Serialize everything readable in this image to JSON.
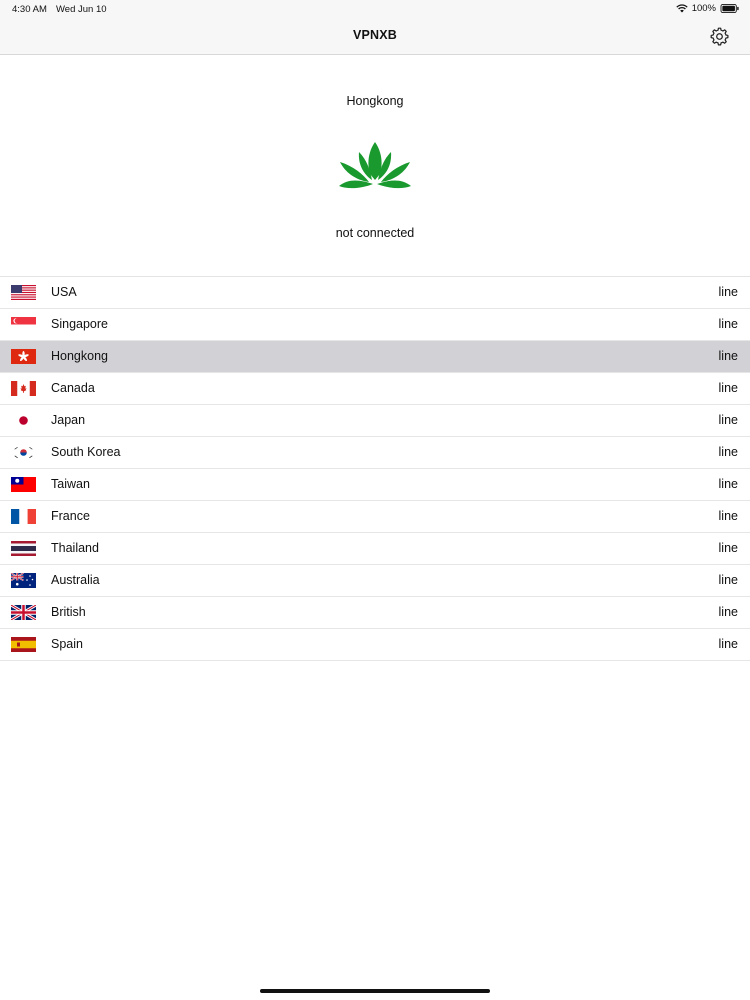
{
  "status_bar": {
    "time": "4:30 AM",
    "date": "Wed Jun 10",
    "battery": "100%"
  },
  "nav": {
    "title": "VPNXB",
    "settings_icon": "gear-icon"
  },
  "current": {
    "server": "Hongkong",
    "status": "not connected",
    "logo_color": "#1a9a2e"
  },
  "colors": {
    "selected_row": "#d2d1d6",
    "divider": "#e6e6e6",
    "nav_bg": "#f7f7f7"
  },
  "servers": [
    {
      "name": "USA",
      "line": "line",
      "flag": "us-flag-icon"
    },
    {
      "name": "Singapore",
      "line": "line",
      "flag": "singapore-flag-icon"
    },
    {
      "name": "Hongkong",
      "line": "line",
      "flag": "hongkong-flag-icon",
      "selected": true
    },
    {
      "name": "Canada",
      "line": "line",
      "flag": "canada-flag-icon"
    },
    {
      "name": "Japan",
      "line": "line",
      "flag": "japan-flag-icon"
    },
    {
      "name": "South Korea",
      "line": "line",
      "flag": "south-korea-flag-icon"
    },
    {
      "name": "Taiwan",
      "line": "line",
      "flag": "taiwan-flag-icon"
    },
    {
      "name": "France",
      "line": "line",
      "flag": "france-flag-icon"
    },
    {
      "name": "Thailand",
      "line": "line",
      "flag": "thailand-flag-icon"
    },
    {
      "name": "Australia",
      "line": "line",
      "flag": "australia-flag-icon"
    },
    {
      "name": "British",
      "line": "line",
      "flag": "uk-flag-icon"
    },
    {
      "name": "Spain",
      "line": "line",
      "flag": "spain-flag-icon"
    }
  ]
}
